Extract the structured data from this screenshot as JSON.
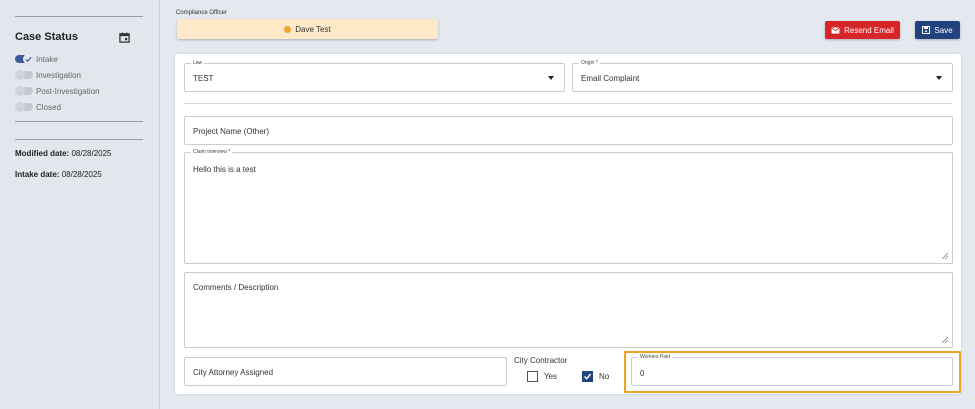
{
  "sidebar": {
    "title": "Case Status",
    "statuses": [
      {
        "label": "Intake",
        "active": true
      },
      {
        "label": "Investigation",
        "active": false
      },
      {
        "label": "Post-Investigation",
        "active": false
      },
      {
        "label": "Closed",
        "active": false
      }
    ],
    "modified_label": "Modified date:",
    "modified_value": "08/28/2025",
    "intake_label": "Intake date:",
    "intake_value": "08/28/2025"
  },
  "header": {
    "compliance_label": "Compliance Officer",
    "officer_name": "Dave Test",
    "resend_label": "Resend Email",
    "save_label": "Save"
  },
  "form": {
    "law_label": "Law",
    "law_value": "TEST",
    "origin_label": "Origin *",
    "origin_value": "Email Complaint",
    "project_name_placeholder": "Project Name (Other)",
    "claim_label": "Claim overview *",
    "claim_value": "Hello this is a test",
    "comments_placeholder": "Comments / Description",
    "attorney_placeholder": "City Attorney Assigned",
    "city_contractor_label": "City Contractor",
    "yes_label": "Yes",
    "yes_checked": false,
    "no_label": "No",
    "no_checked": true,
    "workers_paid_label": "Workers Paid",
    "workers_paid_value": "0"
  },
  "colors": {
    "accent": "#23437f",
    "danger": "#d7262a",
    "chip": "#fde8c8",
    "highlight": "#f2a127"
  }
}
